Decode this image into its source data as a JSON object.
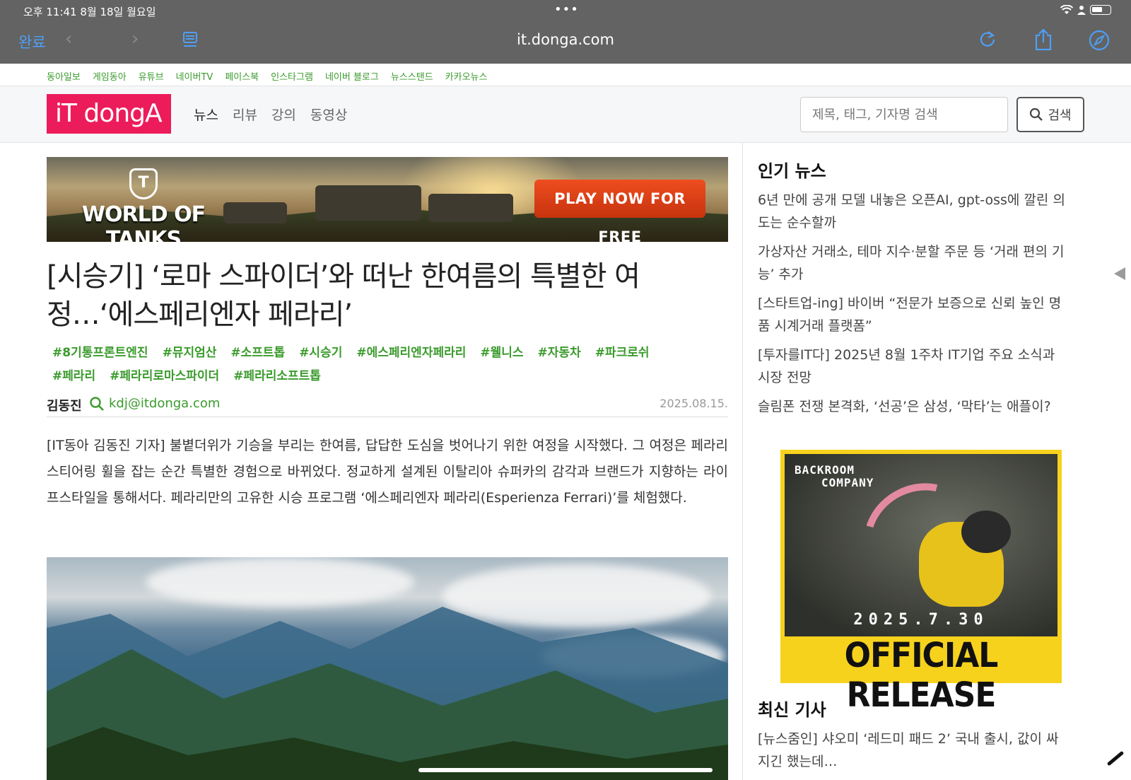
{
  "status_bar": {
    "time": "오후 11:41   8월 18일 월요일",
    "dots": "•••"
  },
  "browser": {
    "done": "완료",
    "back": "‹",
    "forward": "›",
    "url": "it.donga.com"
  },
  "family_links": [
    "동아일보",
    "게임동아",
    "유튜브",
    "네이버TV",
    "페이스북",
    "인스타그램",
    "네이버 블로그",
    "뉴스스탠드",
    "카카오뉴스"
  ],
  "site": {
    "logo": "iT dongA",
    "nav": [
      "뉴스",
      "리뷰",
      "강의",
      "동영상"
    ],
    "search_placeholder": "제목, 태그, 기자명 검색",
    "search_button": "검색"
  },
  "banner_ad": {
    "brand": "WORLD OF TANKS",
    "emblem": "T",
    "cta": "PLAY NOW FOR FREE"
  },
  "article": {
    "title": "[시승기] ‘로마 스파이더’와 떠난 한여름의 특별한 여정…‘에스페리엔자 페라리’",
    "tags": [
      "#8기통프론트엔진",
      "#뮤지엄산",
      "#소프트톱",
      "#시승기",
      "#에스페리엔자페라리",
      "#웰니스",
      "#자동차",
      "#파크로쉬",
      "#페라리",
      "#페라리로마스파이더",
      "#페라리소프트톱"
    ],
    "author": "김동진",
    "email": "kdj@itdonga.com",
    "date": "2025.08.15.",
    "body": "[IT동아 김동진 기자] 불볕더위가 기승을 부리는 한여름, 답답한 도심을 벗어나기 위한 여정을 시작했다. 그 여정은 페라리 스티어링 휠을 잡는 순간 특별한 경험으로 바뀌었다. 정교하게 설계된 이탈리아 슈퍼카의 감각과 브랜드가 지향하는 라이프스타일을 통해서다. 페라리만의 고유한 시승 프로그램 ‘에스페리엔자 페라리(Esperienza Ferrari)’를 체험했다."
  },
  "sidebar": {
    "popular_title": "인기 뉴스",
    "popular": [
      "6년 만에 공개 모델 내놓은 오픈AI, gpt-oss에 깔린 의도는 순수할까",
      "가상자산 거래소, 테마 지수·분할 주문 등 ‘거래 편의 기능’ 추가",
      "[스타트업-ing] 바이버 “전문가 보증으로 신뢰 높인 명품 시계거래 플랫폼”",
      "[투자를IT다] 2025년 8월 1주차 IT기업 주요 소식과 시장 전망",
      "슬림폰 전쟁 본격화, ‘선공’은 삼성, ‘막타’는 애플이?"
    ],
    "ad": {
      "logo_line1": "BACKROOM",
      "logo_line2": "COMPANY",
      "date": "2025.7.30",
      "headline": "OFFICIAL RELEASE"
    },
    "latest_title": "최신 기사",
    "latest": [
      "[뉴스줌인] 샤오미 ‘레드미 패드 2’ 국내 출시, 값이 싸지긴 했는데…"
    ]
  },
  "colors": {
    "accent_green": "#3a9b2c",
    "logo_pink": "#ec1c5b",
    "chrome": "#636363",
    "link_blue": "#4e9ff5"
  }
}
